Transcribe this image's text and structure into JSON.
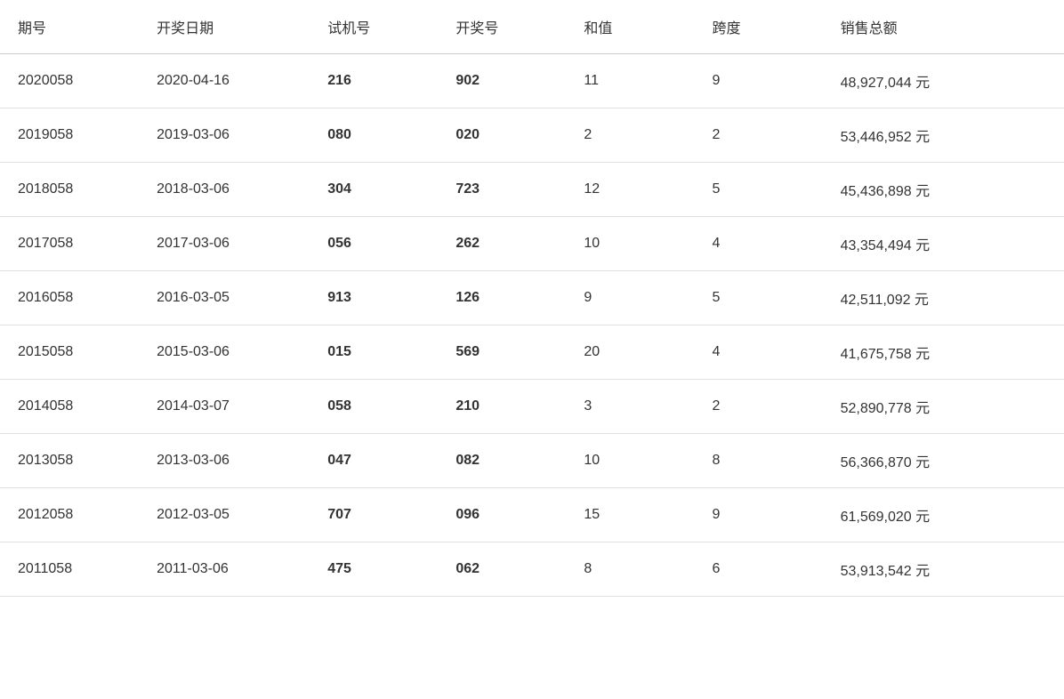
{
  "table": {
    "headers": [
      "期号",
      "开奖日期",
      "试机号",
      "开奖号",
      "和值",
      "跨度",
      "销售总额"
    ],
    "rows": [
      {
        "period": "2020058",
        "date": "2020-04-16",
        "trial": "216",
        "draw": "902",
        "sum": "11",
        "span": "9",
        "sales": "48,927,044 元"
      },
      {
        "period": "2019058",
        "date": "2019-03-06",
        "trial": "080",
        "draw": "020",
        "sum": "2",
        "span": "2",
        "sales": "53,446,952 元"
      },
      {
        "period": "2018058",
        "date": "2018-03-06",
        "trial": "304",
        "draw": "723",
        "sum": "12",
        "span": "5",
        "sales": "45,436,898 元"
      },
      {
        "period": "2017058",
        "date": "2017-03-06",
        "trial": "056",
        "draw": "262",
        "sum": "10",
        "span": "4",
        "sales": "43,354,494 元"
      },
      {
        "period": "2016058",
        "date": "2016-03-05",
        "trial": "913",
        "draw": "126",
        "sum": "9",
        "span": "5",
        "sales": "42,511,092 元"
      },
      {
        "period": "2015058",
        "date": "2015-03-06",
        "trial": "015",
        "draw": "569",
        "sum": "20",
        "span": "4",
        "sales": "41,675,758 元"
      },
      {
        "period": "2014058",
        "date": "2014-03-07",
        "trial": "058",
        "draw": "210",
        "sum": "3",
        "span": "2",
        "sales": "52,890,778 元"
      },
      {
        "period": "2013058",
        "date": "2013-03-06",
        "trial": "047",
        "draw": "082",
        "sum": "10",
        "span": "8",
        "sales": "56,366,870 元"
      },
      {
        "period": "2012058",
        "date": "2012-03-05",
        "trial": "707",
        "draw": "096",
        "sum": "15",
        "span": "9",
        "sales": "61,569,020 元"
      },
      {
        "period": "2011058",
        "date": "2011-03-06",
        "trial": "475",
        "draw": "062",
        "sum": "8",
        "span": "6",
        "sales": "53,913,542 元"
      }
    ]
  }
}
